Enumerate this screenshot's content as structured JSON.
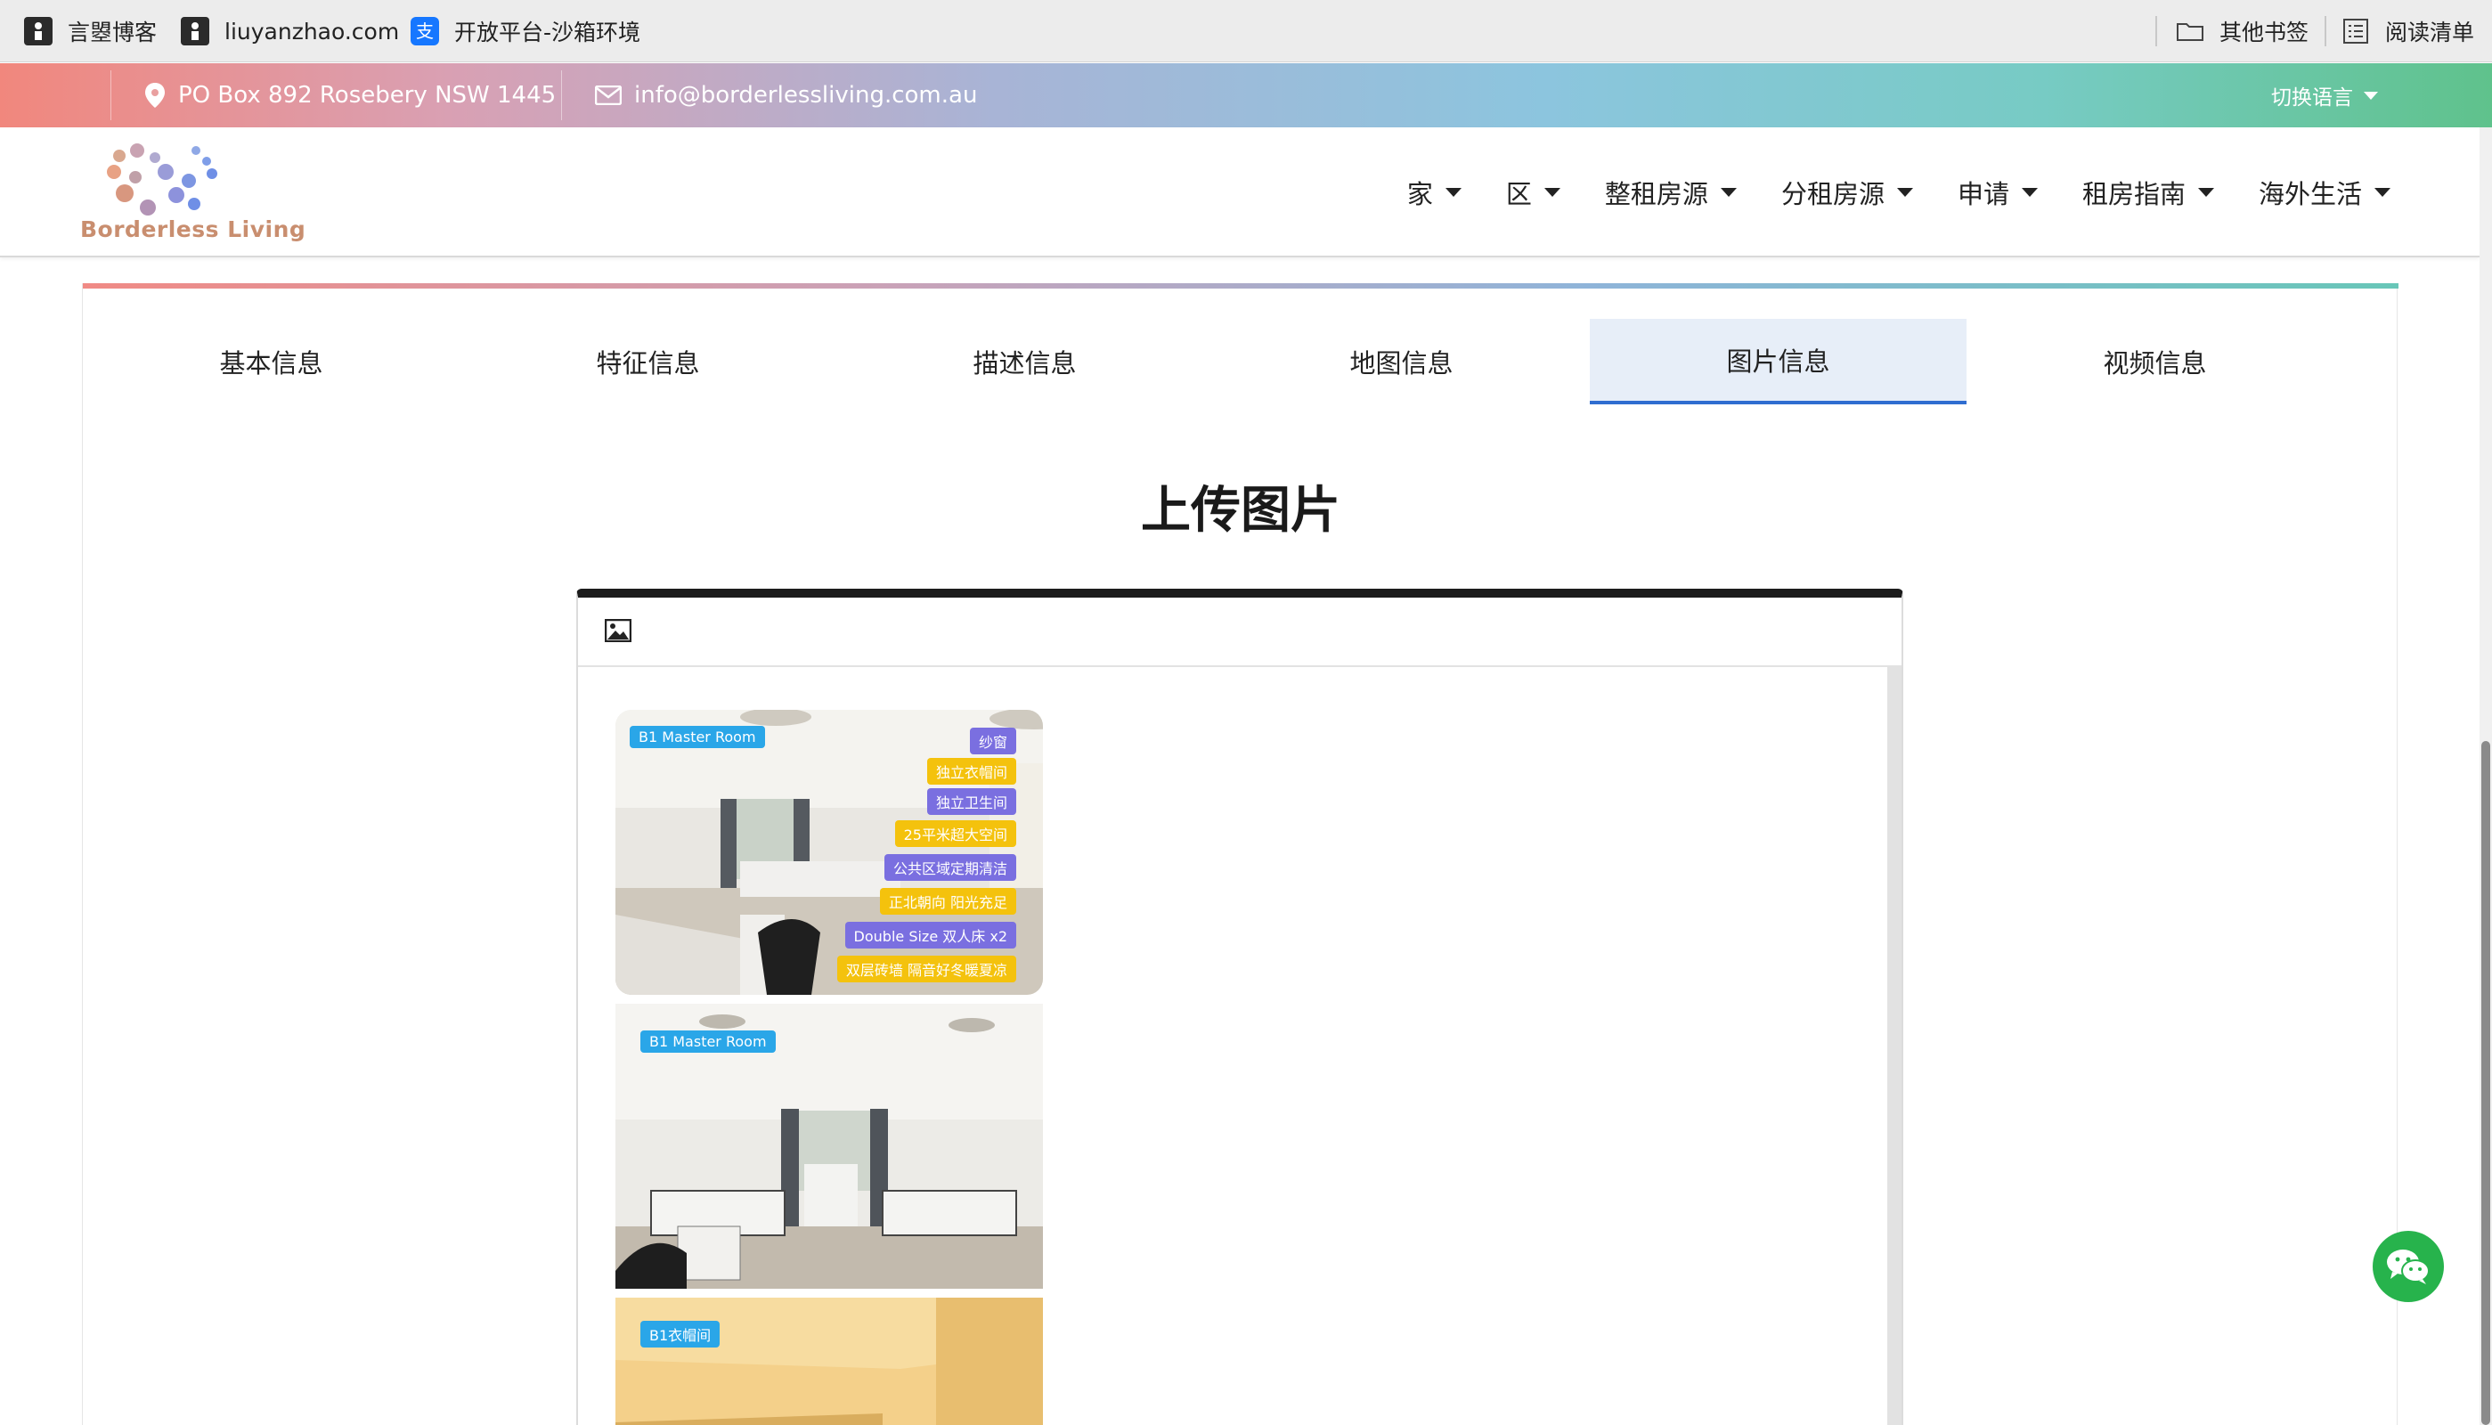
{
  "bookmarks": {
    "items": [
      {
        "label": "言曌博客",
        "icon": "bookmark-favicon-icon"
      },
      {
        "label": "liuyanzhao.com",
        "icon": "bookmark-favicon-icon"
      },
      {
        "label": "开放平台-沙箱环境",
        "icon": "alipay-icon"
      }
    ],
    "other_bookmarks": "其他书签",
    "reading_list": "阅读清单"
  },
  "topbar": {
    "address": "PO Box 892 Rosebery NSW 1445",
    "email": "info@borderlessliving.com.au",
    "language": "切换语言"
  },
  "header": {
    "logo_text": "Borderless Living",
    "nav": [
      "家",
      "区",
      "整租房源",
      "分租房源",
      "申请",
      "租房指南",
      "海外生活"
    ]
  },
  "tabs": [
    "基本信息",
    "特征信息",
    "描述信息",
    "地图信息",
    "图片信息",
    "视频信息"
  ],
  "active_tab": "图片信息",
  "page_title": "上传图片",
  "photos": [
    {
      "room_tag": "B1 Master Room",
      "features": [
        "纱窗",
        "独立衣帽间",
        "独立卫生间",
        "25平米超大空间",
        "公共区域定期清洁",
        "正北朝向 阳光充足",
        "Double Size 双人床 x2",
        "双层砖墙 隔音好冬暖夏凉"
      ]
    },
    {
      "room_tag": "B1 Master Room",
      "features": []
    },
    {
      "room_tag": "B1衣帽间",
      "features": []
    }
  ],
  "colors": {
    "accent_blue": "#2f6dd0",
    "active_tab_bg": "#e7eef8",
    "wechat_green": "#27b34c"
  }
}
